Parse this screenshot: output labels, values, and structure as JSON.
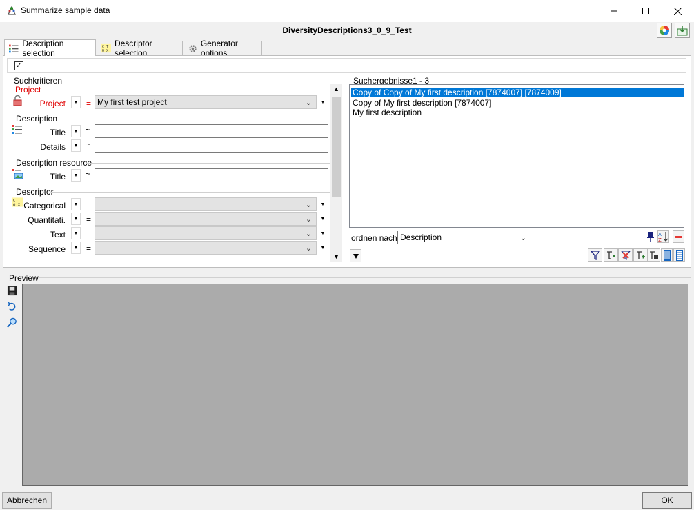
{
  "window": {
    "title": "Summarize sample data",
    "minimize": "—",
    "maximize": "☐",
    "close": "✕"
  },
  "header": {
    "db_name": "DiversityDescriptions3_0_9_Test"
  },
  "tabs": [
    {
      "label": "Description selection",
      "active": true
    },
    {
      "label": "Descriptor selection",
      "active": false
    },
    {
      "label": "Generator options",
      "active": false
    }
  ],
  "toolbar": {
    "checkbox_checked": "✓"
  },
  "search": {
    "group_title": "Suchkritieren",
    "project": {
      "heading": "Project",
      "label": "Project",
      "operator": "=",
      "value": "My first test project"
    },
    "description": {
      "heading": "Description",
      "title_label": "Title",
      "details_label": "Details",
      "operator": "~"
    },
    "description_resource": {
      "heading": "Description resource",
      "title_label": "Title",
      "operator": "~"
    },
    "descriptor": {
      "heading": "Descriptor",
      "rows": [
        {
          "label": "Categorical",
          "operator": "="
        },
        {
          "label": "Quantitati.",
          "operator": "="
        },
        {
          "label": "Text",
          "operator": "="
        },
        {
          "label": "Sequence",
          "operator": "="
        }
      ]
    }
  },
  "results": {
    "title": "Suchergebnisse",
    "count": "1 - 3",
    "items": [
      "Copy of Copy of My first description [7874007] [7874009]",
      "Copy of My first description [7874007]",
      "My first description"
    ],
    "order_label": "ordnen nach:",
    "order_value": "Description"
  },
  "preview": {
    "label": "Preview"
  },
  "buttons": {
    "cancel": "Abbrechen",
    "ok": "OK"
  },
  "colors": {
    "accent": "#0078d7",
    "required": "#e00000",
    "preview_bg": "#ababab"
  }
}
